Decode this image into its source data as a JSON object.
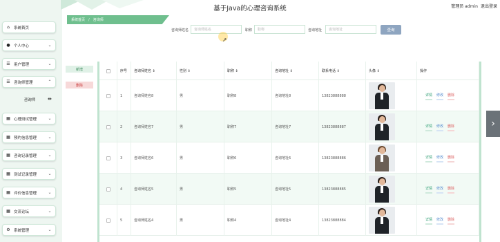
{
  "header": {
    "title": "基于Java的心理咨询系统",
    "user_label": "管理员 admin",
    "logout_label": "退出登录"
  },
  "sidebar": {
    "items": [
      {
        "label": "系统首页",
        "icon": "home-icon",
        "has_chevron": false
      },
      {
        "label": "个人中心",
        "icon": "user-icon",
        "has_chevron": true
      },
      {
        "label": "用户管理",
        "icon": "list-icon",
        "has_chevron": true
      },
      {
        "label": "咨询师管理",
        "icon": "list-icon",
        "has_chevron": true,
        "expanded": true
      },
      {
        "label": "心理测试管理",
        "icon": "grid-icon",
        "has_chevron": true
      },
      {
        "label": "预约信息管理",
        "icon": "grid-icon",
        "has_chevron": true
      },
      {
        "label": "咨询记录管理",
        "icon": "grid-icon",
        "has_chevron": true
      },
      {
        "label": "测试记录管理",
        "icon": "grid-icon",
        "has_chevron": true
      },
      {
        "label": "评价信息管理",
        "icon": "grid-icon",
        "has_chevron": true
      },
      {
        "label": "交流论坛",
        "icon": "grid-icon",
        "has_chevron": true
      },
      {
        "label": "系统管理",
        "icon": "gear-icon",
        "has_chevron": true
      }
    ],
    "submenu_label": "咨询师"
  },
  "breadcrumb": {
    "home": "系统首页",
    "separator": "/",
    "current": "咨询师"
  },
  "search": {
    "name_label": "咨询师姓名",
    "name_placeholder": "咨询师姓名",
    "title_label": "职称",
    "title_placeholder": "职称",
    "address_label": "咨询地址",
    "address_placeholder": "咨询地址",
    "button_label": "查询"
  },
  "actions": {
    "add_label": "新增",
    "delete_label": "删除"
  },
  "table": {
    "columns": [
      "序号",
      "咨询师姓名",
      "性别",
      "职称",
      "咨询地址",
      "联系电话",
      "头像",
      "操作"
    ],
    "rows": [
      {
        "no": "1",
        "name": "咨询师姓名8",
        "gender": "男",
        "title": "职称8",
        "address": "咨询地址8",
        "phone": "13823888888"
      },
      {
        "no": "2",
        "name": "咨询师姓名7",
        "gender": "男",
        "title": "职称7",
        "address": "咨询地址7",
        "phone": "13823888887"
      },
      {
        "no": "3",
        "name": "咨询师姓名6",
        "gender": "男",
        "title": "职称6",
        "address": "咨询地址6",
        "phone": "13823888886"
      },
      {
        "no": "4",
        "name": "咨询师姓名5",
        "gender": "男",
        "title": "职称5",
        "address": "咨询地址5",
        "phone": "13823888885"
      },
      {
        "no": "5",
        "name": "咨询师姓名4",
        "gender": "男",
        "title": "职称4",
        "address": "咨询地址4",
        "phone": "13823888884"
      }
    ],
    "row_actions": {
      "detail": "详情",
      "edit": "修改",
      "remove": "删除"
    }
  },
  "colors": {
    "accent_green": "#6fbf8e",
    "search_button": "#8ea5c0",
    "detail": "#3aa37a",
    "edit": "#5a8fd0",
    "remove": "#dd6666"
  }
}
